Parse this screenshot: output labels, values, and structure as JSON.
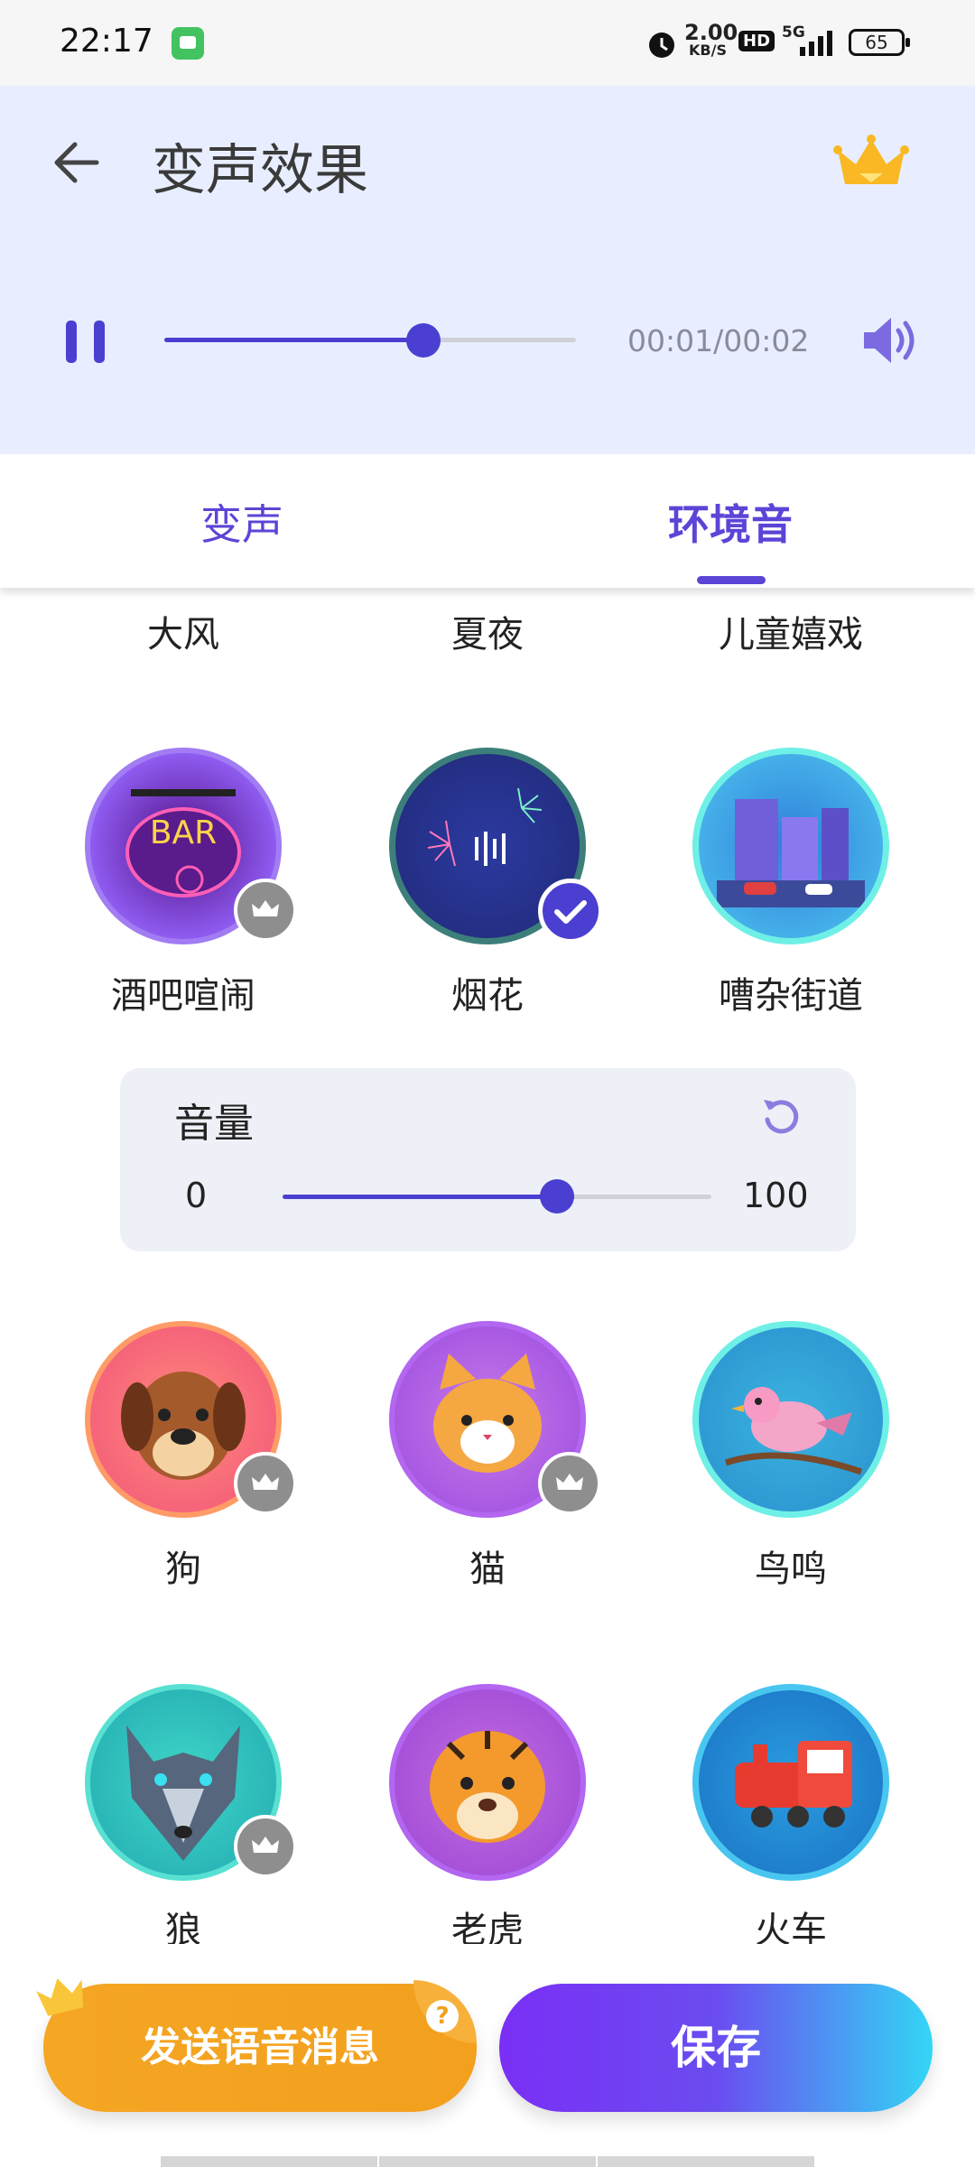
{
  "status_bar": {
    "time": "22:17",
    "net_speed_value": "2.00",
    "net_speed_unit": "KB/S",
    "hd": "HD",
    "network": "5G",
    "battery": "65"
  },
  "header": {
    "title": "变声效果",
    "time": "00:01/00:02",
    "progress": 0.63
  },
  "tabs": {
    "voice": "变声",
    "ambient": "环境音"
  },
  "top_labels": [
    "大风",
    "夏夜",
    "儿童嬉戏"
  ],
  "sounds": [
    {
      "label": "酒吧喧闹",
      "vip": true
    },
    {
      "label": "烟花",
      "selected": true
    },
    {
      "label": "嘈杂街道"
    },
    {
      "label": "狗",
      "vip": true
    },
    {
      "label": "猫",
      "vip": true
    },
    {
      "label": "鸟鸣"
    },
    {
      "label": "狼",
      "vip": true
    },
    {
      "label": "老虎"
    },
    {
      "label": "火车"
    }
  ],
  "volume": {
    "title": "音量",
    "min": "0",
    "max": "100",
    "value": 0.64
  },
  "buttons": {
    "send": "发送语音消息",
    "save": "保存"
  },
  "colors": {
    "accent": "#5b45d7",
    "orange": "#f4a526"
  }
}
